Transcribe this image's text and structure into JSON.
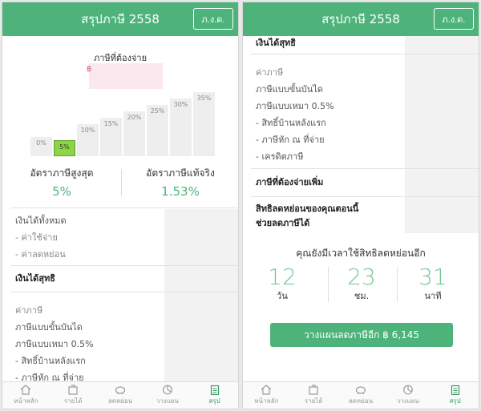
{
  "left": {
    "header_title": "สรุปภาษี 2558",
    "pnd_button": "ภ.ง.ด.",
    "tax_due_label": "ภาษีที่ต้องจ่าย",
    "tax_due_currency": "฿",
    "brackets": [
      "0%",
      "5%",
      "10%",
      "15%",
      "20%",
      "25%",
      "30%",
      "35%"
    ],
    "active_bracket_index": 1,
    "max_rate_label": "อัตราภาษีสูงสุด",
    "max_rate_value": "5%",
    "effective_rate_label": "อัตราภาษีแท้จริง",
    "effective_rate_value": "1.53%",
    "rows": {
      "total_income": "เงินได้ทั้งหมด",
      "expense": "- ค่าใช้จ่าย",
      "deduction": "- ค่าลดหย่อน",
      "net_income": "เงินได้สุทธิ",
      "tax": "ค่าภาษี",
      "progressive": "ภาษีแบบขั้นบันได",
      "flat": "ภาษีแบบเหมา 0.5%",
      "first_home": "- สิทธิ์บ้านหลังแรก",
      "withheld": "- ภาษีหัก ณ ที่จ่าย"
    }
  },
  "right": {
    "header_title": "สรุปภาษี 2558",
    "pnd_button": "ภ.ง.ด.",
    "rows": {
      "net_income": "เงินได้สุทธิ",
      "tax": "ค่าภาษี",
      "progressive": "ภาษีแบบขั้นบันได",
      "flat": "ภาษีแบบเหมา 0.5%",
      "first_home": "- สิทธิ์บ้านหลังแรก",
      "withheld": "- ภาษีหัก ณ ที่จ่าย",
      "credit": "- เครดิตภาษี",
      "tax_payable_more": "ภาษีที่ต้องจ่ายเพิ่ม",
      "deduction_now_1": "สิทธิลดหย่อนของคุณตอนนี้",
      "deduction_now_2": "ช่วยลดภาษีได้"
    },
    "countdown_title": "คุณยังมีเวลาใช้สิทธิลดหย่อนอีก",
    "countdown": [
      {
        "num": "12",
        "unit": "วัน"
      },
      {
        "num": "23",
        "unit": "ชม."
      },
      {
        "num": "31",
        "unit": "นาที"
      }
    ],
    "plan_button": "วางแผนลดภาษีอีก ฿ 6,145"
  },
  "tabs": [
    {
      "label": "หน้าหลัก",
      "icon": "home-icon"
    },
    {
      "label": "รายได้",
      "icon": "income-icon"
    },
    {
      "label": "ลดหย่อน",
      "icon": "piggy-bank-icon"
    },
    {
      "label": "วางแผน",
      "icon": "pie-chart-icon"
    },
    {
      "label": "สรุป",
      "icon": "clipboard-icon"
    }
  ],
  "colors": {
    "accent": "#4db37a",
    "active_bracket": "#8bd546"
  }
}
